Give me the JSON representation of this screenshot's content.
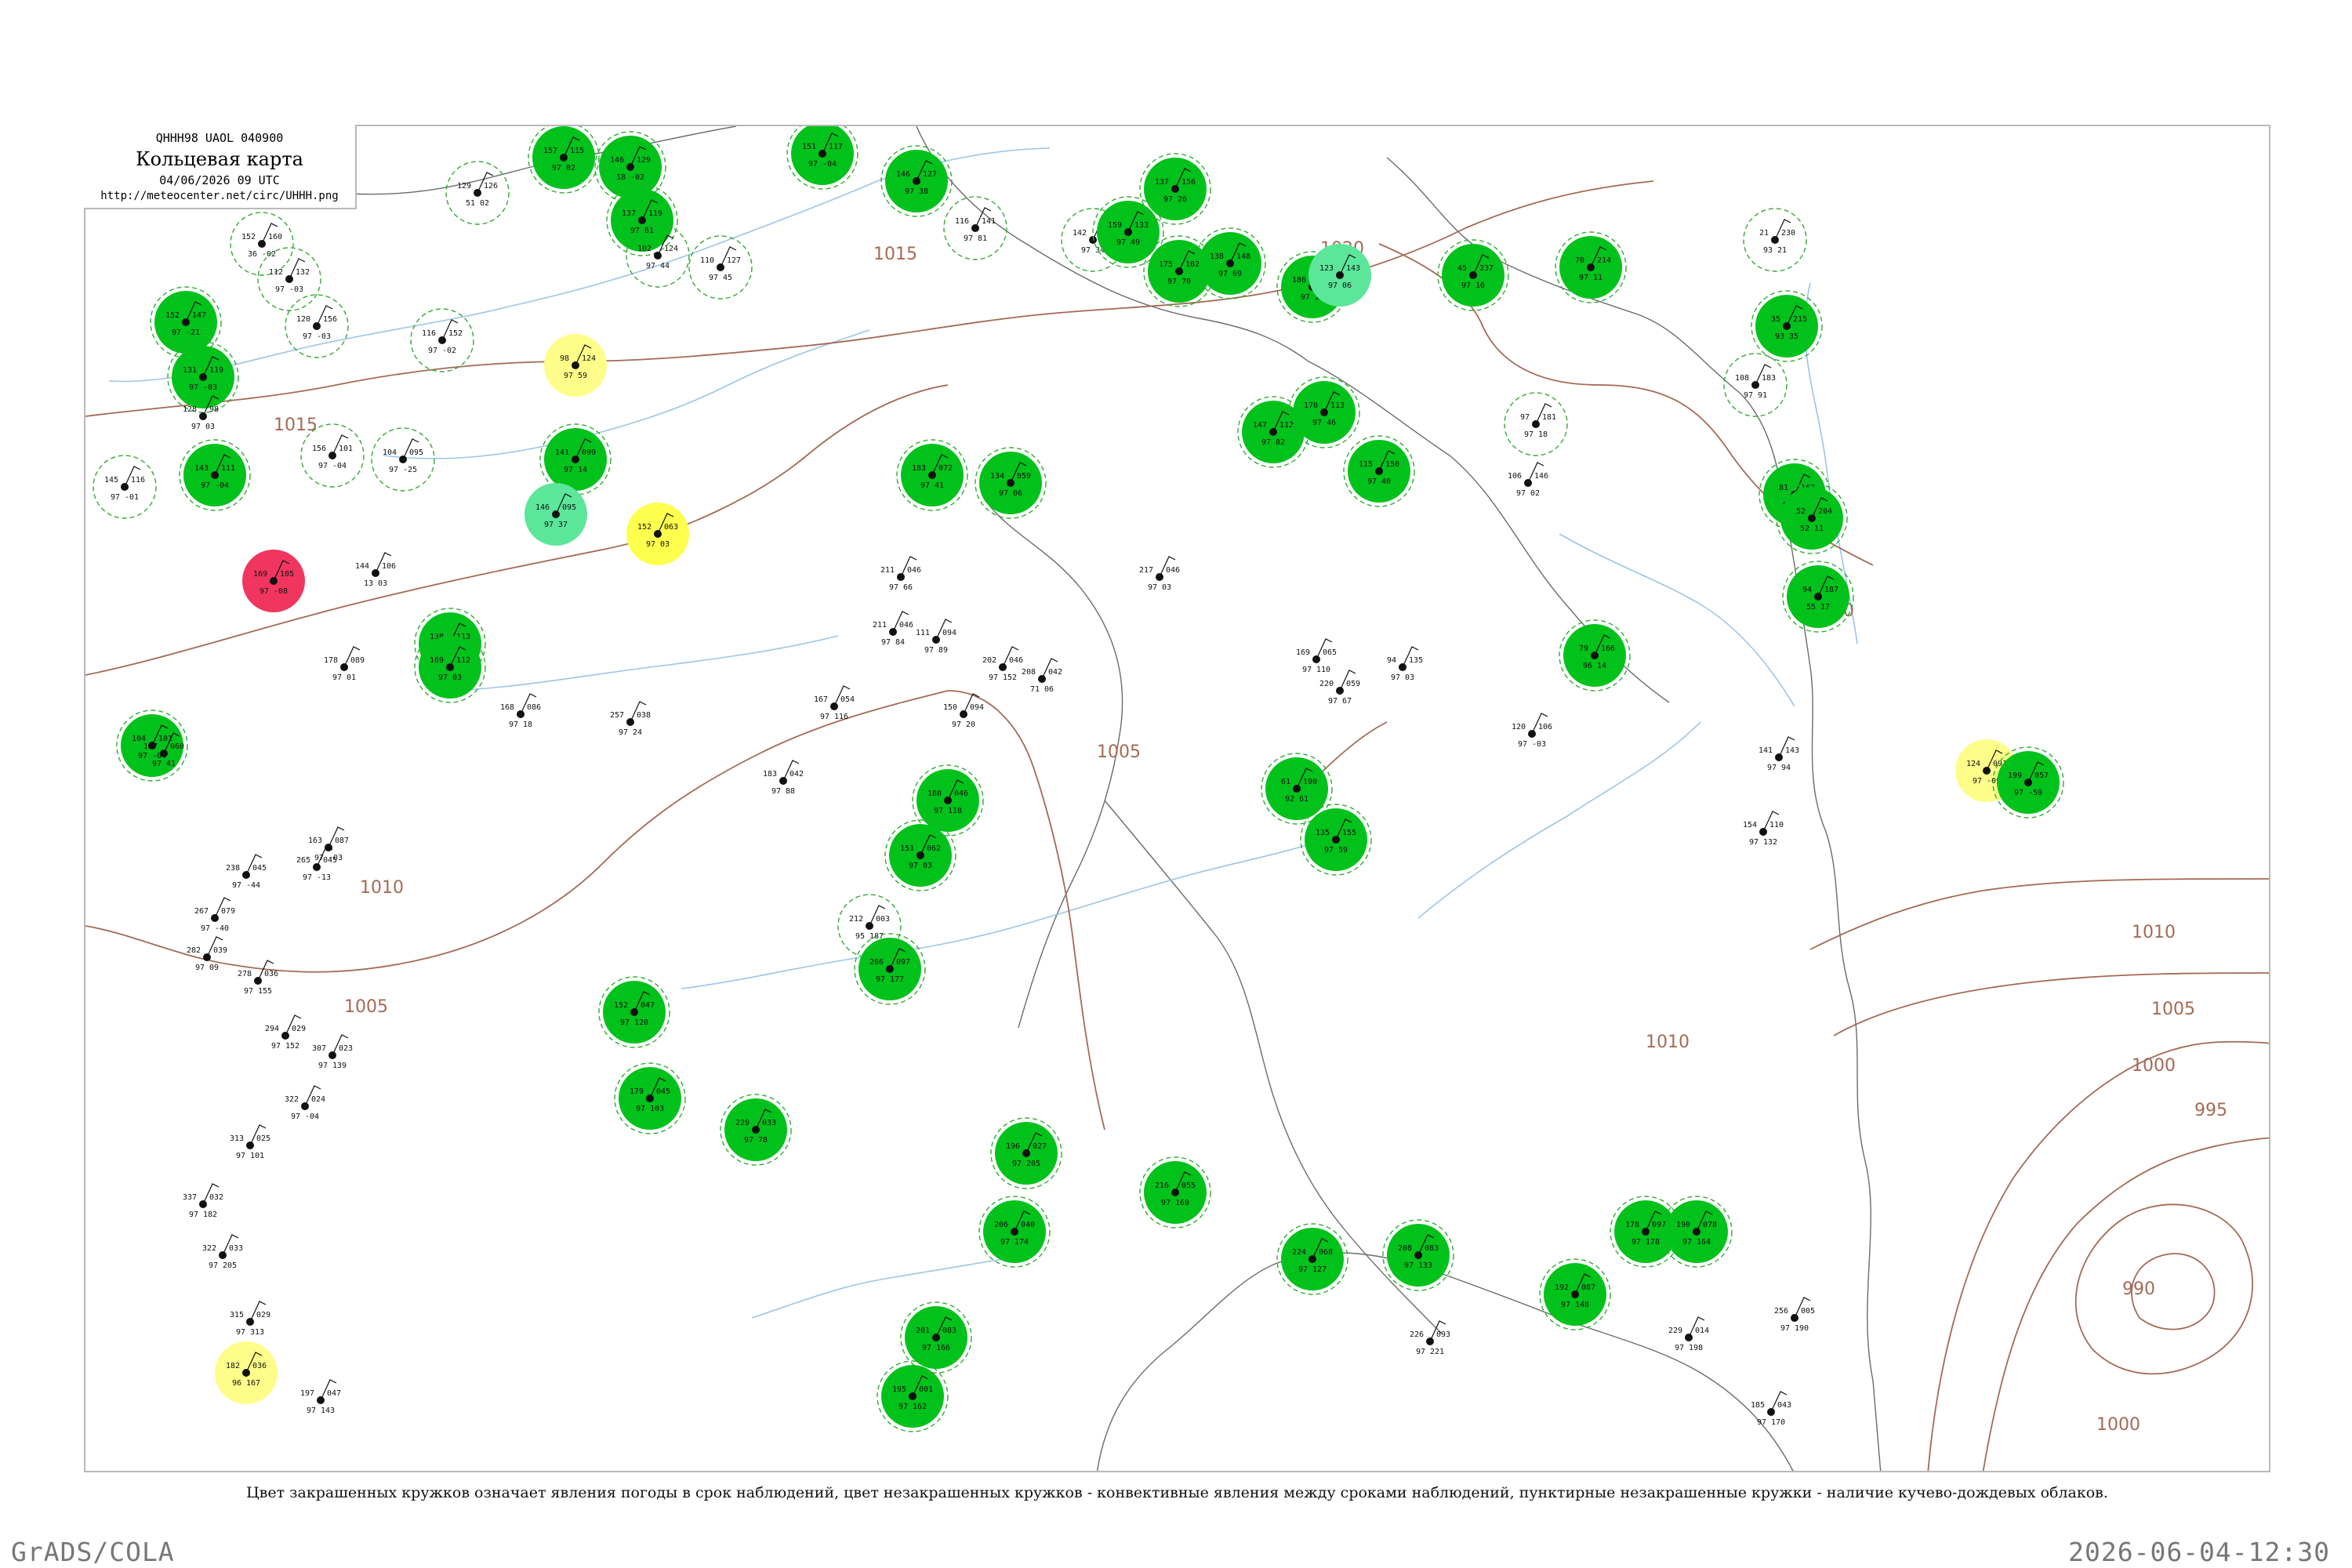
{
  "header": {
    "code": "QHHH98  UAOL  040900",
    "title": "Кольцевая карта",
    "time": "04/06/2026 09 UTC",
    "url": "http://meteocenter.net/circ/UHHH.png"
  },
  "legend_note": "Цвет закрашенных кружков означает явления погоды в срок наблюдений, цвет незакрашенных кружков - конвективные явления между сроками наблюдений, пунктирные незакрашенные кружки - наличие кучево-дождевых облаков.",
  "footer": {
    "left": "GrADS/COLA",
    "right": "2026-06-04-12:30"
  },
  "colors": {
    "isobar": "#a46a55",
    "river": "#9cc5e6",
    "coast": "#6b6b6b",
    "rain_fill": "#00c21b",
    "shower_fill": "#5be69a",
    "fog_fill": "#ffff4d",
    "haze_fill": "#fffd8a",
    "thunder_fill": "#f0365f",
    "cb_ring": "#33aa33"
  },
  "isobars": [
    {
      "label": "1015"
    },
    {
      "label": "1020"
    },
    {
      "label": "1010"
    },
    {
      "label": "1005"
    },
    {
      "label": "1000"
    },
    {
      "label": "995"
    },
    {
      "label": "990"
    }
  ],
  "stations": [
    {
      "id": "1",
      "left": "152",
      "right": "160",
      "sub": "36 -02"
    },
    {
      "id": "2",
      "left": "112",
      "right": "132",
      "sub": "97 -03"
    },
    {
      "id": "3",
      "left": "152",
      "right": "147",
      "sub": "97 -21"
    },
    {
      "id": "4",
      "left": "131",
      "right": "119",
      "sub": "97 -03"
    },
    {
      "id": "5",
      "left": "128",
      "right": "98",
      "sub": "97 03"
    },
    {
      "id": "6",
      "left": "145",
      "right": "116",
      "sub": "97 -01"
    },
    {
      "id": "7",
      "left": "143",
      "right": "111",
      "sub": "97 -04"
    },
    {
      "id": "8",
      "left": "156",
      "right": "101",
      "sub": "97 -04"
    },
    {
      "id": "9",
      "left": "104",
      "right": "095",
      "sub": "97 -25"
    },
    {
      "id": "10",
      "left": "120",
      "right": "156",
      "sub": "97 -03"
    },
    {
      "id": "11",
      "left": "116",
      "right": "152",
      "sub": "97 -02"
    },
    {
      "id": "12",
      "left": "129",
      "right": "126",
      "sub": "51 02"
    },
    {
      "id": "13",
      "left": "157",
      "right": "115",
      "sub": "97 02"
    },
    {
      "id": "14",
      "left": "146",
      "right": "129",
      "sub": "18 -02"
    },
    {
      "id": "15",
      "left": "137",
      "right": "119",
      "sub": "97 61"
    },
    {
      "id": "16",
      "left": "102",
      "right": "124",
      "sub": "97 44"
    },
    {
      "id": "17",
      "left": "110",
      "right": "127",
      "sub": "97 45"
    },
    {
      "id": "18",
      "left": "151",
      "right": "117",
      "sub": "97 -04"
    },
    {
      "id": "19",
      "left": "146",
      "right": "127",
      "sub": "97 38"
    },
    {
      "id": "20",
      "left": "116",
      "right": "141",
      "sub": "97 81"
    },
    {
      "id": "21",
      "left": "142",
      "right": "126",
      "sub": "97 34"
    },
    {
      "id": "22",
      "left": "159",
      "right": "133",
      "sub": "97 49"
    },
    {
      "id": "23",
      "left": "137",
      "right": "156",
      "sub": "97 26"
    },
    {
      "id": "24",
      "left": "175",
      "right": "102",
      "sub": "97 70"
    },
    {
      "id": "25",
      "left": "138",
      "right": "148",
      "sub": "97 69"
    },
    {
      "id": "26",
      "left": "186",
      "right": "106",
      "sub": "97 28"
    },
    {
      "id": "27",
      "left": "123",
      "right": "143",
      "sub": "97 06"
    },
    {
      "id": "28",
      "left": "45",
      "right": "237",
      "sub": "97 16"
    },
    {
      "id": "29",
      "left": "70",
      "right": "214",
      "sub": "97 11"
    },
    {
      "id": "30",
      "left": "21",
      "right": "230",
      "sub": "93 21"
    },
    {
      "id": "31",
      "left": "35",
      "right": "215",
      "sub": "93 35"
    },
    {
      "id": "32",
      "left": "98",
      "right": "124",
      "sub": "97 59"
    },
    {
      "id": "33",
      "left": "141",
      "right": "099",
      "sub": "97 14"
    },
    {
      "id": "34",
      "left": "146",
      "right": "095",
      "sub": "97 37"
    },
    {
      "id": "35",
      "left": "152",
      "right": "063",
      "sub": "97 03"
    },
    {
      "id": "36",
      "left": "183",
      "right": "072",
      "sub": "97 41"
    },
    {
      "id": "37",
      "left": "134",
      "right": "059",
      "sub": "97 06"
    },
    {
      "id": "38",
      "left": "147",
      "right": "112",
      "sub": "97 82"
    },
    {
      "id": "39",
      "left": "170",
      "right": "113",
      "sub": "97 46"
    },
    {
      "id": "40",
      "left": "115",
      "right": "150",
      "sub": "97 40"
    },
    {
      "id": "41",
      "left": "97",
      "right": "181",
      "sub": "97 18"
    },
    {
      "id": "42",
      "left": "106",
      "right": "146",
      "sub": "97 02"
    },
    {
      "id": "43",
      "left": "108",
      "right": "183",
      "sub": "97 91"
    },
    {
      "id": "44",
      "left": "81",
      "right": "162",
      "sub": "97 52"
    },
    {
      "id": "45",
      "left": "52",
      "right": "204",
      "sub": "52 11"
    },
    {
      "id": "46",
      "left": "94",
      "right": "187",
      "sub": "55 17"
    },
    {
      "id": "47",
      "left": "79",
      "right": "166",
      "sub": "96 14"
    },
    {
      "id": "48",
      "left": "169",
      "right": "105",
      "sub": "97 -08"
    },
    {
      "id": "49",
      "left": "144",
      "right": "106",
      "sub": "13 03"
    },
    {
      "id": "50",
      "left": "178",
      "right": "089",
      "sub": "97 01"
    },
    {
      "id": "51",
      "left": "138",
      "right": "113",
      "sub": "97 02"
    },
    {
      "id": "52",
      "left": "169",
      "right": "112",
      "sub": "97 03"
    },
    {
      "id": "53",
      "left": "104",
      "right": "101",
      "sub": "97 -04"
    },
    {
      "id": "54",
      "left": "187",
      "right": "060",
      "sub": "97 41"
    },
    {
      "id": "55",
      "left": "211",
      "right": "046",
      "sub": "97 66"
    },
    {
      "id": "56",
      "left": "211",
      "right": "046",
      "sub": "97 84"
    },
    {
      "id": "57",
      "left": "111",
      "right": "094",
      "sub": "97 89"
    },
    {
      "id": "58",
      "left": "217",
      "right": "046",
      "sub": "97 03"
    },
    {
      "id": "59",
      "left": "167",
      "right": "054",
      "sub": "97 116"
    },
    {
      "id": "60",
      "left": "208",
      "right": "042",
      "sub": "71 06"
    },
    {
      "id": "61",
      "left": "150",
      "right": "094",
      "sub": "97 20"
    },
    {
      "id": "62",
      "left": "168",
      "right": "086",
      "sub": "97 18"
    },
    {
      "id": "63",
      "left": "257",
      "right": "038",
      "sub": "97 24"
    },
    {
      "id": "64",
      "left": "183",
      "right": "042",
      "sub": "97 88"
    },
    {
      "id": "65",
      "left": "180",
      "right": "046",
      "sub": "97 118"
    },
    {
      "id": "66",
      "left": "151",
      "right": "062",
      "sub": "97 03"
    },
    {
      "id": "67",
      "left": "202",
      "right": "046",
      "sub": "97 152"
    },
    {
      "id": "68",
      "left": "169",
      "right": "065",
      "sub": "97 110"
    },
    {
      "id": "69",
      "left": "220",
      "right": "059",
      "sub": "97 67"
    },
    {
      "id": "70",
      "left": "94",
      "right": "135",
      "sub": "97 03"
    },
    {
      "id": "71",
      "left": "120",
      "right": "106",
      "sub": "97 -03"
    },
    {
      "id": "72",
      "left": "141",
      "right": "143",
      "sub": "97 94"
    },
    {
      "id": "73",
      "left": "154",
      "right": "110",
      "sub": "97 132"
    },
    {
      "id": "74",
      "left": "61",
      "right": "190",
      "sub": "92 61"
    },
    {
      "id": "75",
      "left": "135",
      "right": "155",
      "sub": "97 59"
    },
    {
      "id": "76",
      "left": "124",
      "right": "091",
      "sub": "97 -09"
    },
    {
      "id": "77",
      "left": "199",
      "right": "057",
      "sub": "97 -59"
    },
    {
      "id": "78",
      "left": "163",
      "right": "087",
      "sub": "97 -03"
    },
    {
      "id": "79",
      "left": "238",
      "right": "045",
      "sub": "97 -44"
    },
    {
      "id": "80",
      "left": "265",
      "right": "045",
      "sub": "97 -13"
    },
    {
      "id": "81",
      "left": "267",
      "right": "079",
      "sub": "97 -40"
    },
    {
      "id": "82",
      "left": "282",
      "right": "039",
      "sub": "97 09"
    },
    {
      "id": "83",
      "left": "278",
      "right": "036",
      "sub": "97 155"
    },
    {
      "id": "84",
      "left": "294",
      "right": "029",
      "sub": "97 152"
    },
    {
      "id": "85",
      "left": "307",
      "right": "023",
      "sub": "97 139"
    },
    {
      "id": "86",
      "left": "322",
      "right": "024",
      "sub": "97 -04"
    },
    {
      "id": "87",
      "left": "313",
      "right": "025",
      "sub": "97 101"
    },
    {
      "id": "88",
      "left": "337",
      "right": "032",
      "sub": "97 182"
    },
    {
      "id": "89",
      "left": "322",
      "right": "033",
      "sub": "97 205"
    },
    {
      "id": "90",
      "left": "315",
      "right": "029",
      "sub": "97 313"
    },
    {
      "id": "91",
      "left": "182",
      "right": "036",
      "sub": "96 167"
    },
    {
      "id": "92",
      "left": "197",
      "right": "047",
      "sub": "97 143"
    },
    {
      "id": "93",
      "left": "229",
      "right": "033",
      "sub": "97 78"
    },
    {
      "id": "94",
      "left": "179",
      "right": "045",
      "sub": "97 103"
    },
    {
      "id": "95",
      "left": "152",
      "right": "047",
      "sub": "97 120"
    },
    {
      "id": "96",
      "left": "212",
      "right": "003",
      "sub": "95 187"
    },
    {
      "id": "97",
      "left": "266",
      "right": "097",
      "sub": "97 177"
    },
    {
      "id": "98",
      "left": "196",
      "right": "027",
      "sub": "97 205"
    },
    {
      "id": "99",
      "left": "206",
      "right": "040",
      "sub": "97 174"
    },
    {
      "id": "100",
      "left": "216",
      "right": "055",
      "sub": "97 169"
    },
    {
      "id": "101",
      "left": "224",
      "right": "068",
      "sub": "97 127"
    },
    {
      "id": "102",
      "left": "208",
      "right": "083",
      "sub": "97 133"
    },
    {
      "id": "103",
      "left": "192",
      "right": "087",
      "sub": "97 148"
    },
    {
      "id": "104",
      "left": "178",
      "right": "097",
      "sub": "97 178"
    },
    {
      "id": "105",
      "left": "190",
      "right": "078",
      "sub": "97 164"
    },
    {
      "id": "106",
      "left": "229",
      "right": "014",
      "sub": "97 198"
    },
    {
      "id": "107",
      "left": "256",
      "right": "005",
      "sub": "97 190"
    },
    {
      "id": "108",
      "left": "185",
      "right": "043",
      "sub": "97 170"
    },
    {
      "id": "109",
      "left": "195",
      "right": "001",
      "sub": "97 162"
    },
    {
      "id": "110",
      "left": "201",
      "right": "083",
      "sub": "97 166"
    },
    {
      "id": "111",
      "left": "226",
      "right": "093",
      "sub": "97 221"
    }
  ]
}
